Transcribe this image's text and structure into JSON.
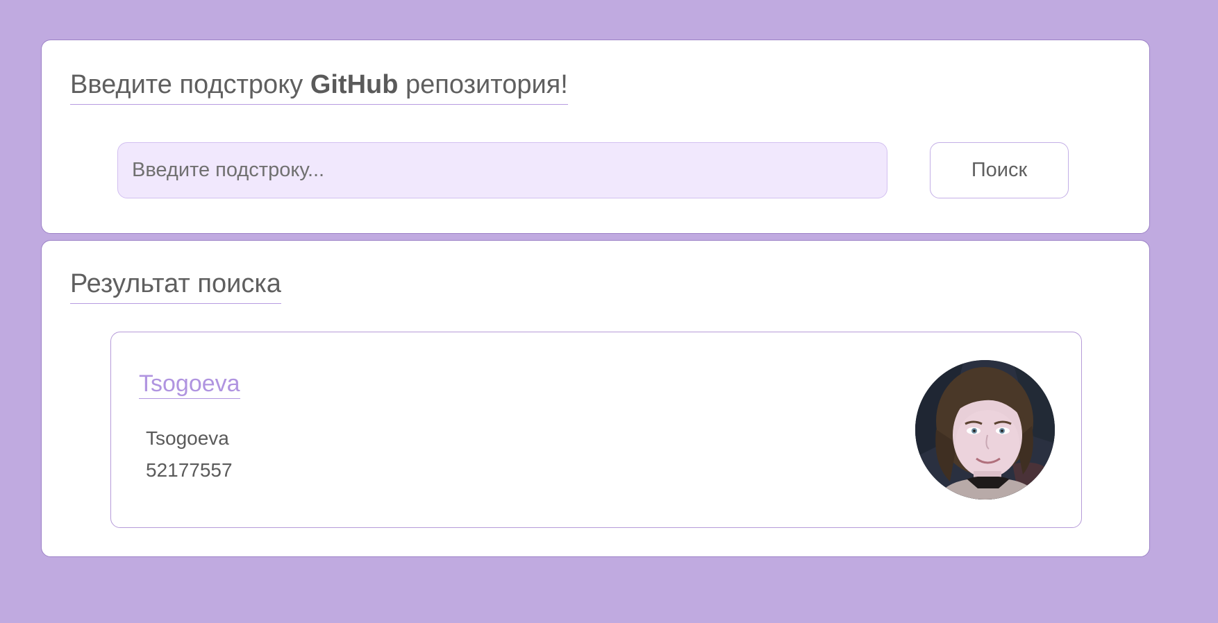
{
  "search": {
    "title_prefix": "Введите подстроку ",
    "title_bold": "GitHub",
    "title_suffix": " репозитория!",
    "input_placeholder": "Введите подстроку...",
    "input_value": "",
    "button_label": "Поиск"
  },
  "results": {
    "title": "Результат поиска",
    "items": [
      {
        "name": "Tsogoeva",
        "login": "Tsogoeva",
        "id": "52177557",
        "avatar_icon": "user-avatar-photo"
      }
    ]
  },
  "colors": {
    "background": "#c0aae0",
    "panel": "#ffffff",
    "accent": "#b094e0",
    "input_bg": "#f1e8fd",
    "text": "#5f5f5f"
  }
}
